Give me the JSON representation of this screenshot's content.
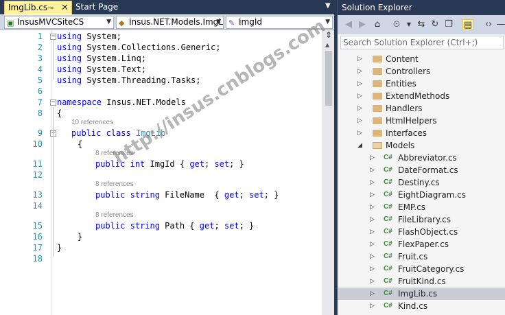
{
  "editor": {
    "active_tab": "ImgLib.cs",
    "pin_glyph": "⊸",
    "close_glyph": "✕",
    "start_tab": "Start Page",
    "nav": {
      "project": "InsusMVCSiteCS",
      "type": "Insus.NET.Models.ImgL",
      "member": "ImgId"
    },
    "lines": [
      {
        "n": "1",
        "code": [
          {
            "k": "kw",
            "t": "using"
          },
          {
            "k": "",
            "t": " System;"
          }
        ]
      },
      {
        "n": "2",
        "code": [
          {
            "k": "kw",
            "t": "using"
          },
          {
            "k": "",
            "t": " System.Collections.Generic;"
          }
        ]
      },
      {
        "n": "3",
        "code": [
          {
            "k": "kw",
            "t": "using"
          },
          {
            "k": "",
            "t": " System.Linq;"
          }
        ]
      },
      {
        "n": "4",
        "code": [
          {
            "k": "kw",
            "t": "using"
          },
          {
            "k": "",
            "t": " System.Text;"
          }
        ]
      },
      {
        "n": "5",
        "code": [
          {
            "k": "kw",
            "t": "using"
          },
          {
            "k": "",
            "t": " System.Threading.Tasks;"
          }
        ]
      },
      {
        "n": "6",
        "code": []
      },
      {
        "n": "7",
        "code": [
          {
            "k": "kw",
            "t": "namespace"
          },
          {
            "k": "",
            "t": " Insus.NET.Models"
          }
        ]
      },
      {
        "n": "8",
        "code": [
          {
            "k": "",
            "t": "{"
          }
        ]
      },
      {
        "n": "9",
        "code": [
          {
            "k": "kw",
            "t": "public"
          },
          {
            "k": "",
            "t": " "
          },
          {
            "k": "kw",
            "t": "class"
          },
          {
            "k": "",
            "t": " "
          },
          {
            "k": "ty",
            "t": "ImgLib"
          }
        ],
        "ref": "10 references"
      },
      {
        "n": "10",
        "code": [
          {
            "k": "",
            "t": "{"
          }
        ]
      },
      {
        "n": "11",
        "code": [
          {
            "k": "kw",
            "t": "public"
          },
          {
            "k": "",
            "t": " "
          },
          {
            "k": "kw",
            "t": "int"
          },
          {
            "k": "",
            "t": " ImgId { "
          },
          {
            "k": "kw",
            "t": "get"
          },
          {
            "k": "",
            "t": "; "
          },
          {
            "k": "kw",
            "t": "set"
          },
          {
            "k": "",
            "t": "; }"
          }
        ],
        "ref": "8 references"
      },
      {
        "n": "12",
        "code": []
      },
      {
        "n": "13",
        "code": [
          {
            "k": "kw",
            "t": "public"
          },
          {
            "k": "",
            "t": " "
          },
          {
            "k": "kw",
            "t": "string"
          },
          {
            "k": "",
            "t": " FileName  { "
          },
          {
            "k": "kw",
            "t": "get"
          },
          {
            "k": "",
            "t": "; "
          },
          {
            "k": "kw",
            "t": "set"
          },
          {
            "k": "",
            "t": "; }"
          }
        ],
        "ref": "8 references"
      },
      {
        "n": "14",
        "code": []
      },
      {
        "n": "15",
        "code": [
          {
            "k": "kw",
            "t": "public"
          },
          {
            "k": "",
            "t": " "
          },
          {
            "k": "kw",
            "t": "string"
          },
          {
            "k": "",
            "t": " Path { "
          },
          {
            "k": "kw",
            "t": "get"
          },
          {
            "k": "",
            "t": "; "
          },
          {
            "k": "kw",
            "t": "set"
          },
          {
            "k": "",
            "t": "; }"
          }
        ],
        "ref": "8 references"
      },
      {
        "n": "16",
        "code": [
          {
            "k": "",
            "t": "}"
          }
        ]
      },
      {
        "n": "17",
        "code": [
          {
            "k": "",
            "t": "}"
          }
        ]
      },
      {
        "n": "18",
        "code": []
      }
    ]
  },
  "watermark": "http://insus.cnblogs.com",
  "solution_explorer": {
    "title": "Solution Explorer",
    "search_placeholder": "Search Solution Explorer (Ctrl+;)",
    "toolbar_icons": [
      "back-icon",
      "forward-icon",
      "home-icon",
      "history-icon",
      "sync-icon",
      "refresh-icon",
      "collapse-all-icon",
      "show-all-files-icon",
      "view-code-icon",
      "more-icon"
    ],
    "items": [
      {
        "label": "Content",
        "kind": "folder",
        "expanded": false
      },
      {
        "label": "Controllers",
        "kind": "folder",
        "expanded": false
      },
      {
        "label": "Entities",
        "kind": "folder",
        "expanded": false
      },
      {
        "label": "ExtendMethods",
        "kind": "folder",
        "expanded": false
      },
      {
        "label": "Handlers",
        "kind": "folder",
        "expanded": false
      },
      {
        "label": "HtmlHelpers",
        "kind": "folder",
        "expanded": false
      },
      {
        "label": "Interfaces",
        "kind": "folder",
        "expanded": false
      },
      {
        "label": "Models",
        "kind": "folder",
        "expanded": true
      },
      {
        "label": "Abbreviator.cs",
        "kind": "cs"
      },
      {
        "label": "DateFormat.cs",
        "kind": "cs"
      },
      {
        "label": "Destiny.cs",
        "kind": "cs"
      },
      {
        "label": "EightDiagram.cs",
        "kind": "cs"
      },
      {
        "label": "EMP.cs",
        "kind": "cs"
      },
      {
        "label": "FileLibrary.cs",
        "kind": "cs"
      },
      {
        "label": "FlashObject.cs",
        "kind": "cs"
      },
      {
        "label": "FlexPaper.cs",
        "kind": "cs"
      },
      {
        "label": "Fruit.cs",
        "kind": "cs"
      },
      {
        "label": "FruitCategory.cs",
        "kind": "cs"
      },
      {
        "label": "FruitKind.cs",
        "kind": "cs"
      },
      {
        "label": "ImgLib.cs",
        "kind": "cs",
        "selected": true
      },
      {
        "label": "Kind.cs",
        "kind": "cs"
      }
    ],
    "cs_badge": "C#"
  },
  "colors": {
    "keyword": "#0000ff",
    "type": "#2b91af",
    "line_number": "#2b91af",
    "active_tab": "#fff29d",
    "chrome": "#293955"
  }
}
